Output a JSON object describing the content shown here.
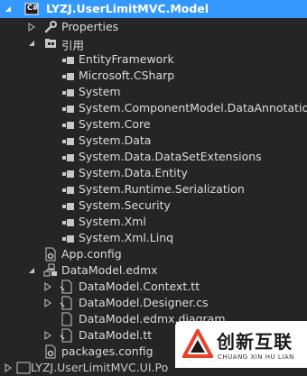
{
  "tree": {
    "project": "LYZJ.UserLimitMVC.Model",
    "project_icon_text": "C#",
    "properties": "Properties",
    "references": "引用",
    "reference_items": [
      "EntityFramework",
      "Microsoft.CSharp",
      "System",
      "System.ComponentModel.DataAnnotations",
      "System.Core",
      "System.Data",
      "System.Data.DataSetExtensions",
      "System.Data.Entity",
      "System.Runtime.Serialization",
      "System.Security",
      "System.Xml",
      "System.Xml.Linq"
    ],
    "app_config": "App.config",
    "edmx": "DataModel.edmx",
    "edmx_children": [
      "DataModel.Context.tt",
      "DataModel.Designer.cs",
      "DataModel.edmx.diagram",
      "DataModel.tt"
    ],
    "packages_config": "packages.config",
    "next_project": "LYZJ.UserLimitMVC.UI.Po"
  },
  "watermark": {
    "cn": "创新互联",
    "en": "CHUANG XIN HU LIAN"
  }
}
